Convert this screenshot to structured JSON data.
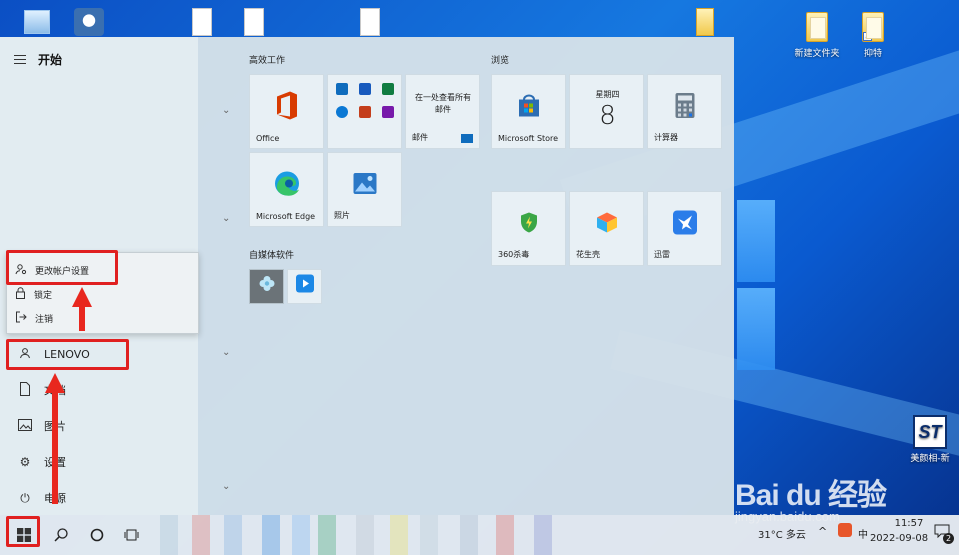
{
  "desktop": {
    "icons": [
      {
        "label": "新建文件夹",
        "icon": "folder-icon"
      },
      {
        "label": "抑特",
        "icon": "folder-shortcut-icon"
      },
      {
        "label": "美颜相-新",
        "icon": "st-app-icon"
      }
    ],
    "watermark": "Bai du 经验",
    "watermark_url": "jingyan.baidu.com"
  },
  "start": {
    "title": "开始",
    "rail": {
      "items": [
        {
          "label": "LENOVO",
          "icon": "user-icon"
        },
        {
          "label": "文档",
          "icon": "document-icon"
        },
        {
          "label": "图片",
          "icon": "picture-icon"
        },
        {
          "label": "设置",
          "icon": "gear-icon"
        },
        {
          "label": "电源",
          "icon": "power-icon"
        }
      ]
    },
    "account_menu": {
      "items": [
        {
          "label": "更改帐户设置",
          "icon": "account-settings-icon"
        },
        {
          "label": "锁定",
          "icon": "lock-icon"
        },
        {
          "label": "注销",
          "icon": "sign-out-icon"
        }
      ]
    },
    "groups": [
      {
        "title": "高效工作"
      },
      {
        "title": "浏览"
      },
      {
        "title": "自媒体软件"
      }
    ],
    "tiles": {
      "office": "Office",
      "mail_line1": "在一处查看所有",
      "mail_line2": "邮件",
      "mail_label": "邮件",
      "store": "Microsoft Store",
      "calendar_day": "星期四",
      "calendar_date": "8",
      "calculator": "计算器",
      "edge": "Microsoft Edge",
      "photos": "照片",
      "security360": "360杀毒",
      "huashengke": "花生壳",
      "xunlei": "迅雷"
    }
  },
  "taskbar": {
    "weather": "31°C 多云",
    "time": "11:57",
    "date": "2022-09-08",
    "notification_count": "2",
    "input": "中"
  },
  "colors": {
    "highlight": "#e02020",
    "desktop": "#1678e0",
    "start_bg": "#d6e2e9"
  }
}
